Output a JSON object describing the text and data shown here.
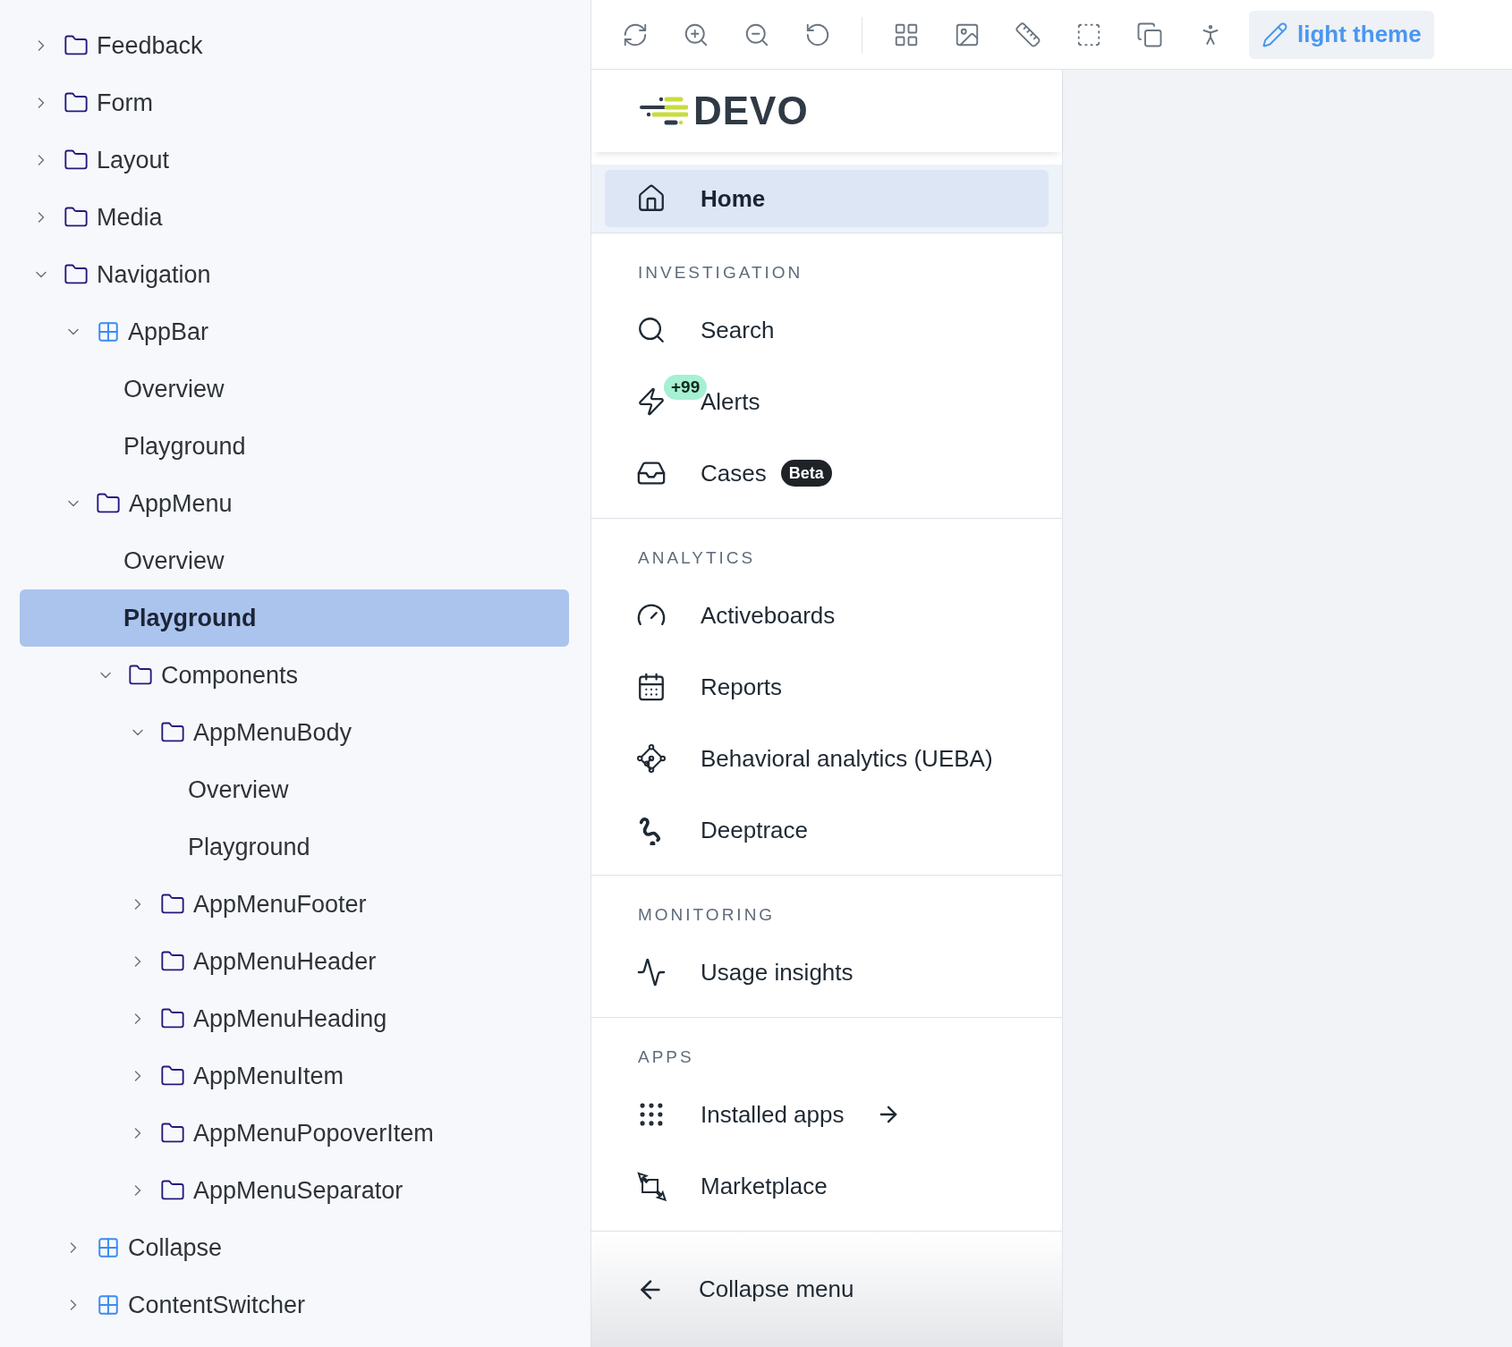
{
  "tree": [
    {
      "label": "Feedback",
      "kind": "folder",
      "expanded": false,
      "selected": false
    },
    {
      "label": "Form",
      "kind": "folder",
      "expanded": false,
      "selected": false
    },
    {
      "label": "Layout",
      "kind": "folder",
      "expanded": false,
      "selected": false
    },
    {
      "label": "Media",
      "kind": "folder",
      "expanded": false,
      "selected": false
    },
    {
      "label": "Navigation",
      "kind": "folder",
      "expanded": true,
      "selected": false,
      "children": [
        {
          "label": "AppBar",
          "kind": "component",
          "expanded": true,
          "selected": false,
          "children": [
            {
              "label": "Overview",
              "kind": "story",
              "selected": false
            },
            {
              "label": "Playground",
              "kind": "story",
              "selected": false
            }
          ]
        },
        {
          "label": "AppMenu",
          "kind": "folder",
          "expanded": true,
          "selected": false,
          "children": [
            {
              "label": "Overview",
              "kind": "story",
              "selected": false
            },
            {
              "label": "Playground",
              "kind": "story",
              "selected": true
            },
            {
              "label": "Components",
              "kind": "folder",
              "expanded": true,
              "selected": false,
              "children": [
                {
                  "label": "AppMenuBody",
                  "kind": "folder",
                  "expanded": true,
                  "selected": false,
                  "children": [
                    {
                      "label": "Overview",
                      "kind": "story",
                      "selected": false
                    },
                    {
                      "label": "Playground",
                      "kind": "story",
                      "selected": false
                    }
                  ]
                },
                {
                  "label": "AppMenuFooter",
                  "kind": "folder",
                  "expanded": false,
                  "selected": false
                },
                {
                  "label": "AppMenuHeader",
                  "kind": "folder",
                  "expanded": false,
                  "selected": false
                },
                {
                  "label": "AppMenuHeading",
                  "kind": "folder",
                  "expanded": false,
                  "selected": false
                },
                {
                  "label": "AppMenuItem",
                  "kind": "folder",
                  "expanded": false,
                  "selected": false
                },
                {
                  "label": "AppMenuPopoverItem",
                  "kind": "folder",
                  "expanded": false,
                  "selected": false
                },
                {
                  "label": "AppMenuSeparator",
                  "kind": "folder",
                  "expanded": false,
                  "selected": false
                }
              ]
            }
          ]
        },
        {
          "label": "Collapse",
          "kind": "component",
          "expanded": false,
          "selected": false
        },
        {
          "label": "ContentSwitcher",
          "kind": "component",
          "expanded": false,
          "selected": false
        }
      ]
    }
  ],
  "toolbar": {
    "theme_button": "light theme"
  },
  "app_menu": {
    "logo": "DEVO",
    "home": {
      "label": "Home",
      "selected": true
    },
    "sections": [
      {
        "heading": "INVESTIGATION",
        "items": [
          {
            "label": "Search",
            "selected": false
          },
          {
            "label": "Alerts",
            "badge": "+99",
            "selected": false
          },
          {
            "label": "Cases",
            "tag": "Beta",
            "selected": false
          }
        ]
      },
      {
        "heading": "ANALYTICS",
        "items": [
          {
            "label": "Activeboards",
            "selected": false
          },
          {
            "label": "Reports",
            "selected": false
          },
          {
            "label": "Behavioral analytics (UEBA)",
            "selected": false
          },
          {
            "label": "Deeptrace",
            "selected": false
          }
        ]
      },
      {
        "heading": "MONITORING",
        "items": [
          {
            "label": "Usage insights",
            "selected": false
          }
        ]
      },
      {
        "heading": "APPS",
        "items": [
          {
            "label": "Installed apps",
            "selected": false
          },
          {
            "label": "Marketplace",
            "selected": false
          }
        ]
      }
    ],
    "collapse": "Collapse menu"
  }
}
